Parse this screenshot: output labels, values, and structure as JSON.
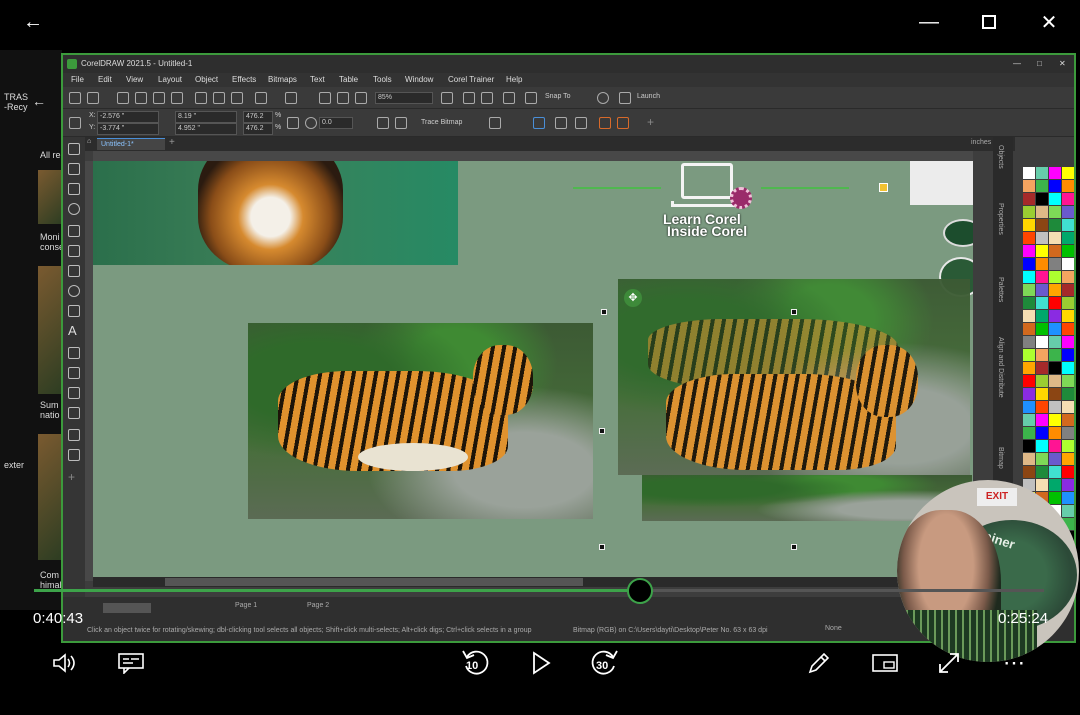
{
  "colors": {
    "accent": "#3da34a",
    "corel_border": "#3c9a3c",
    "canvas": "#7b9a80"
  },
  "window": {
    "back_icon": "arrow-left-icon",
    "minimize_icon": "minimize-icon",
    "maximize_icon": "maximize-icon",
    "close_icon": "close-icon"
  },
  "desktop": {
    "recycle_label": "TRAS\n-Recy",
    "all_label": "All re",
    "item1": "Moni\nconse",
    "item2": "Sum\nnatio",
    "item3": "Com\nhimal",
    "ext_label": "exter"
  },
  "corel": {
    "title": "CorelDRAW 2021.5 - Untitled-1",
    "menu": [
      "File",
      "Edit",
      "View",
      "Layout",
      "Object",
      "Effects",
      "Bitmaps",
      "Text",
      "Table",
      "Tools",
      "Window",
      "Corel Trainer",
      "Help"
    ],
    "zoom": "85%",
    "snap_to": "Snap To",
    "launch": "Launch",
    "x_field": "-2.576 \"",
    "y_field": "-3.774 \"",
    "w_field": "8.19 \"",
    "h_field": "4.952 \"",
    "scale_x": "476.2",
    "scale_y": "476.2",
    "pct": "%",
    "rotation": "0.0",
    "trace_bitmap": "Trace Bitmap",
    "doc_tab": "Untitled-1*",
    "ruler_unit": "inches",
    "dockers": [
      "Objects",
      "Properties",
      "Palettes",
      "Align and Distribute",
      "Bitmap"
    ],
    "status_hint": "Click an object twice for rotating/skewing; dbl-clicking tool selects all objects; Shift+click multi-selects; Alt+click digs; Ctrl+click selects in a group",
    "status_info": "Bitmap (RGB) on C:\\Users\\dayti\\Desktop\\Peter No. 63 x 63 dpi",
    "fill_none": "None",
    "page1": "Page 1",
    "page2": "Page 2"
  },
  "canvas": {
    "logo_line1": "Learn Corel",
    "logo_line2": "Inside Corel"
  },
  "player": {
    "elapsed": "0:40:43",
    "remaining": "0:25:24",
    "progress": 0.6,
    "skip_back": "10",
    "skip_fwd": "30",
    "volume_icon": "volume-icon",
    "captions_icon": "captions-icon",
    "rewind_icon": "rewind-10-icon",
    "play_icon": "play-icon",
    "forward_icon": "forward-30-icon",
    "edit_icon": "pencil-icon",
    "miniview_icon": "miniview-icon",
    "fullscreen_icon": "fullscreen-icon",
    "more_icon": "more-icon"
  },
  "webcam": {
    "exit_sign": "EXIT",
    "banner": "el Trainer"
  }
}
